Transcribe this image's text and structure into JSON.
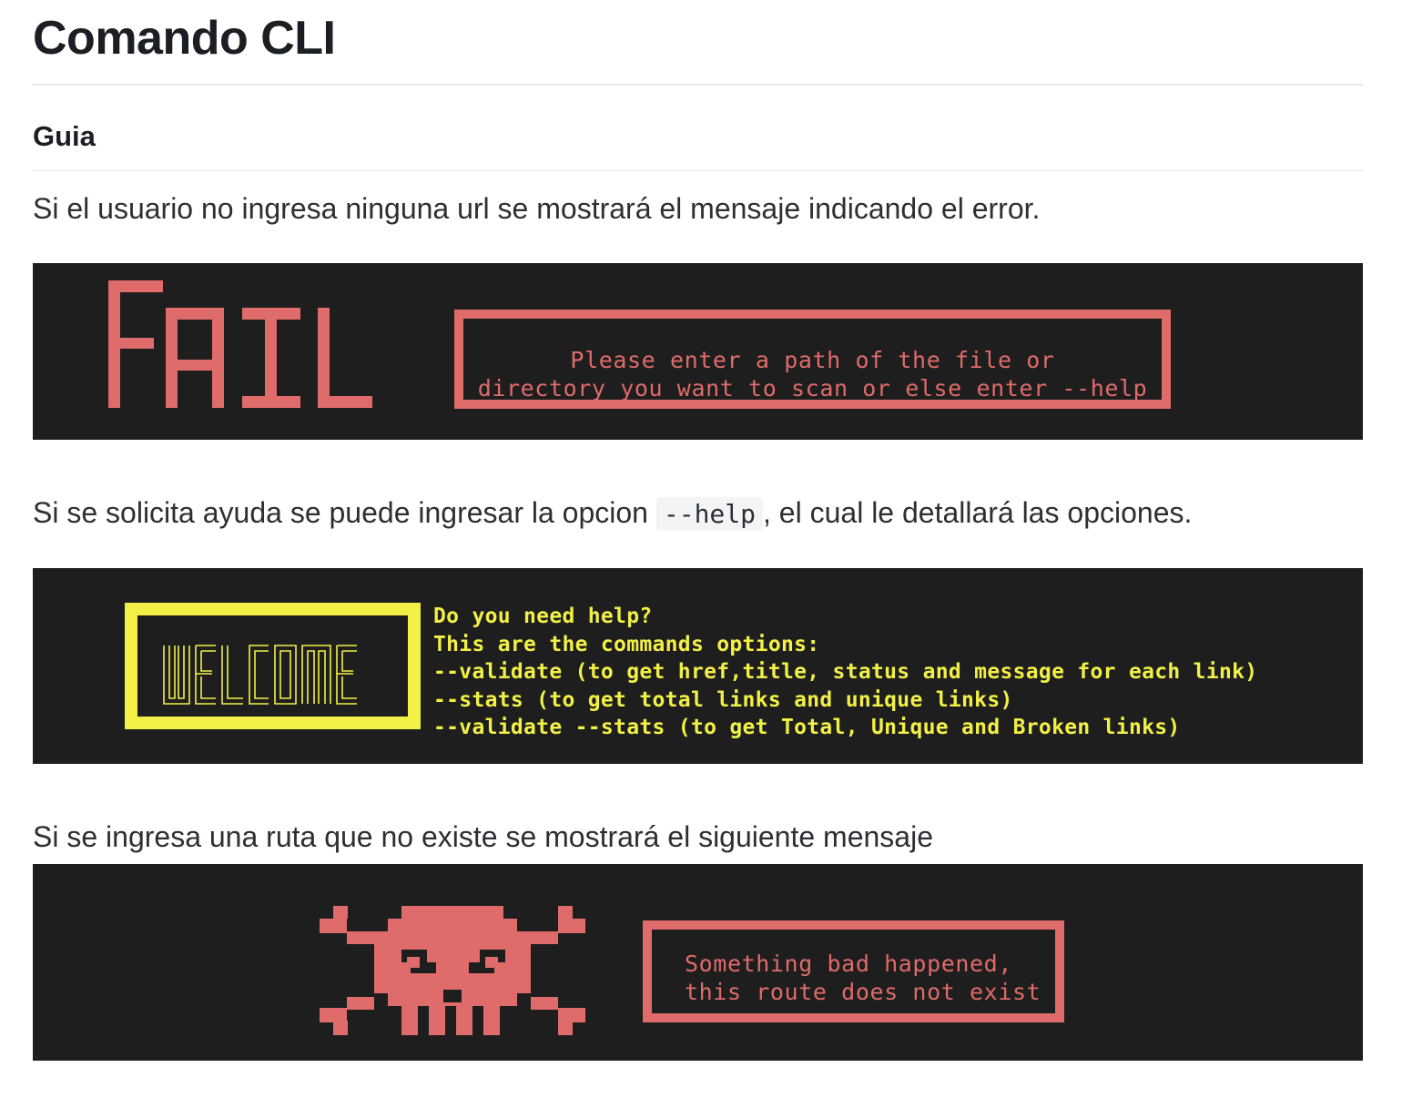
{
  "page": {
    "title": "Comando CLI",
    "subtitle": "Guia",
    "para1": "Si el usuario no ingresa ninguna url se mostrará el mensaje indicando el error.",
    "para2_before": "Si se solicita ayuda se puede ingresar la opcion ",
    "para2_code": "--help",
    "para2_after": ", el cual le detallará las opciones.",
    "para3": "Si se ingresa una ruta que no existe se mostrará el siguiente mensaje"
  },
  "terminal1": {
    "art_text": "FAIL",
    "line1": "Please enter a path of the file or",
    "line2": "directory you want to scan or else enter --help"
  },
  "terminal2": {
    "art_text": "WELCOME",
    "lines": [
      "Do you need help?",
      "This are the commands options:",
      "--validate (to get href,title, status and message for each link)",
      "--stats (to get total links and unique links)",
      "--validate --stats (to get Total, Unique and Broken links)"
    ]
  },
  "terminal3": {
    "art_icon": "skull-crossbones-icon",
    "line1": "Something bad happened,",
    "line2": "this route does not exist"
  },
  "colors": {
    "terminal_bg": "#1e1e1e",
    "red": "#df6b6a",
    "yellow": "#f2f046"
  }
}
